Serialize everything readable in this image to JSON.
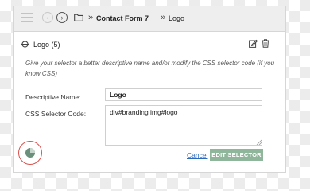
{
  "toolbar": {
    "menu_icon": "hamburger-icon",
    "back_icon": "circle-arrow-left-icon",
    "forward_icon": "circle-arrow-right-icon",
    "folder_icon": "folder-icon",
    "breadcrumb": {
      "separator_1": "»",
      "page": "Contact Form 7",
      "separator_2": "»",
      "current": "Logo"
    }
  },
  "panel": {
    "title": "Logo (5)",
    "hint": "Give your selector a better descriptive name and/or modify the CSS selector code (if you know CSS)",
    "descriptive_name_label": "Descriptive Name:",
    "descriptive_name_value": "Logo",
    "css_selector_label": "CSS Selector Code:",
    "css_selector_value": "div#branding img#logo",
    "cancel_label": "Cancel",
    "edit_selector_label": "EDIT SELECTOR"
  },
  "colors": {
    "edit_button": "#8fb69a",
    "link": "#2b6bbf",
    "highlight_ring": "#d9534f"
  }
}
